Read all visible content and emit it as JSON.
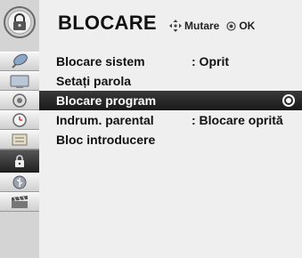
{
  "header": {
    "title": "BLOCARE",
    "hint": {
      "move_label": "Mutare",
      "ok_label": "OK"
    }
  },
  "sidebar": {
    "items": [
      {
        "icon": "satellite-dish-icon"
      },
      {
        "icon": "picture-icon"
      },
      {
        "icon": "audio-speaker-icon"
      },
      {
        "icon": "clock-icon"
      },
      {
        "icon": "options-icon"
      },
      {
        "icon": "lock-icon",
        "active": true
      },
      {
        "icon": "usb-icon"
      },
      {
        "icon": "movie-clapper-icon"
      }
    ]
  },
  "menu": {
    "items": [
      {
        "label": "Blocare sistem",
        "value": ": Oprit"
      },
      {
        "label": "Setați parola",
        "value": ""
      },
      {
        "label": "Blocare program",
        "value": "",
        "selected": true
      },
      {
        "label": "Indrum. parental",
        "value": ": Blocare oprită"
      },
      {
        "label": "Bloc introducere",
        "value": ""
      }
    ]
  },
  "colors": {
    "selected_bg": "#222222",
    "panel_bg": "#efefef",
    "sidebar_bg": "#d4d4d4"
  }
}
